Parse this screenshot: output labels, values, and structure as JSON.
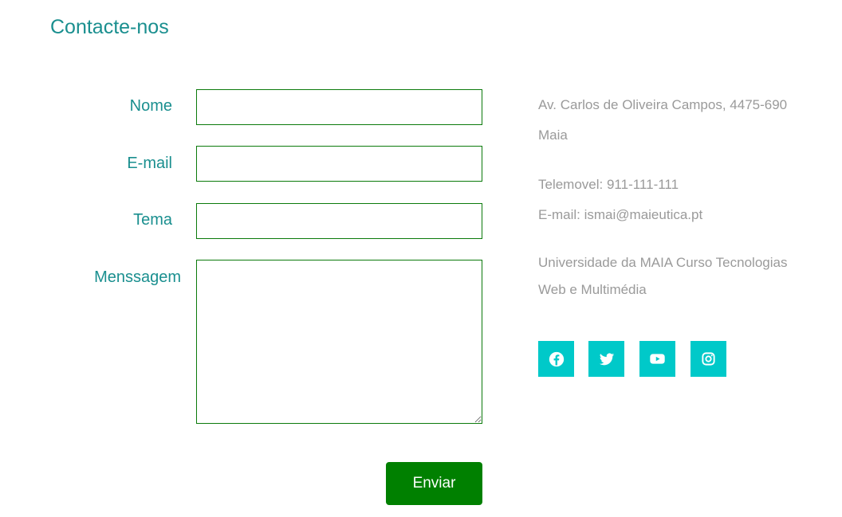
{
  "header": {
    "title": "Contacte-nos"
  },
  "form": {
    "name_label": "Nome",
    "name_value": "",
    "email_label": "E-mail",
    "email_value": "",
    "subject_label": "Tema",
    "subject_value": "",
    "message_label": "Menssagem",
    "message_value": "",
    "submit_label": "Enviar"
  },
  "contact_info": {
    "address_line1": "Av. Carlos de Oliveira Campos, 4475-690",
    "address_line2": "Maia",
    "phone": "Telemovel: 911-111-111",
    "email": "E-mail: ismai@maieutica.pt",
    "institution_line1": "Universidade da MAIA Curso Tecnologias",
    "institution_line2": "Web e Multimédia"
  },
  "social": {
    "accent_color": "#00c9c9",
    "icons": [
      "facebook-icon",
      "twitter-icon",
      "youtube-icon",
      "instagram-icon"
    ]
  },
  "colors": {
    "title": "#1a8f8f",
    "label": "#1a8f8f",
    "field_border": "#0b7a0b",
    "button": "#008000",
    "info_text": "#9a9a9a"
  }
}
